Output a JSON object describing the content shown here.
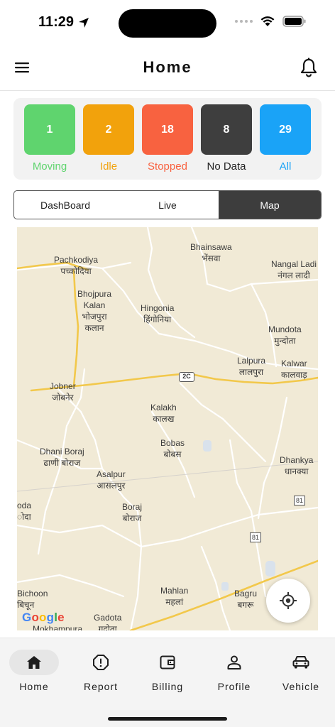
{
  "status_bar": {
    "time": "11:29"
  },
  "header": {
    "title": "Home"
  },
  "filters": [
    {
      "count": "1",
      "label": "Moving",
      "color": "#5fd46e",
      "label_color": "#5fd46e"
    },
    {
      "count": "2",
      "label": "Idle",
      "color": "#f2a20c",
      "label_color": "#f2a20c"
    },
    {
      "count": "18",
      "label": "Stopped",
      "color": "#f86240",
      "label_color": "#f86240"
    },
    {
      "count": "8",
      "label": "No Data",
      "color": "#3e3e3e",
      "label_color": "#222222"
    },
    {
      "count": "29",
      "label": "All",
      "color": "#1aa3f7",
      "label_color": "#1aa3f7"
    }
  ],
  "segments": [
    {
      "label": "DashBoard",
      "active": false
    },
    {
      "label": "Live",
      "active": false
    },
    {
      "label": "Map",
      "active": true
    }
  ],
  "map": {
    "places": [
      {
        "en": "Pachkodiya",
        "hi": "पच्कोदिया"
      },
      {
        "en": "Bhainsawa",
        "hi": "भेंसवा"
      },
      {
        "en": "Nangal Ladi",
        "hi": "नंगल लादी"
      },
      {
        "en": "Bhojpura Kalan",
        "hi": "भोजपुरा कलान"
      },
      {
        "en": "Hingonia",
        "hi": "हिंगोनिया"
      },
      {
        "en": "Mundota",
        "hi": "मुन्दोता"
      },
      {
        "en": "Lalpura",
        "hi": "लालपुरा"
      },
      {
        "en": "Kalwar",
        "hi": "कालवाड़"
      },
      {
        "en": "Jobner",
        "hi": "जोबनेर"
      },
      {
        "en": "Kalakh",
        "hi": "कालख"
      },
      {
        "en": "Bobas",
        "hi": "बोबस"
      },
      {
        "en": "Dhani Boraj",
        "hi": "ढाणी बोराज"
      },
      {
        "en": "Dhankya",
        "hi": "धानक्या"
      },
      {
        "en": "Asalpur",
        "hi": "आसलपुर"
      },
      {
        "en": "oda",
        "hi": "ोदा"
      },
      {
        "en": "Boraj",
        "hi": "बोराज"
      },
      {
        "en": "Bichoon",
        "hi": "बिचून"
      },
      {
        "en": "Mahlan",
        "hi": "महलां"
      },
      {
        "en": "Bagru",
        "hi": "बगरू"
      },
      {
        "en": "Gadota",
        "hi": "गदोता"
      },
      {
        "en": "Mokhampura",
        "hi": ""
      }
    ],
    "road_labels": [
      "2C",
      "81",
      "81"
    ],
    "logo": "Google"
  },
  "bottom_nav": [
    {
      "label": "Home",
      "icon": "home-icon",
      "active": true
    },
    {
      "label": "Report",
      "icon": "report-alert-icon",
      "active": false
    },
    {
      "label": "Billing",
      "icon": "wallet-icon",
      "active": false
    },
    {
      "label": "Profile",
      "icon": "user-icon",
      "active": false
    },
    {
      "label": "Vehicle",
      "icon": "car-icon",
      "active": false
    }
  ]
}
